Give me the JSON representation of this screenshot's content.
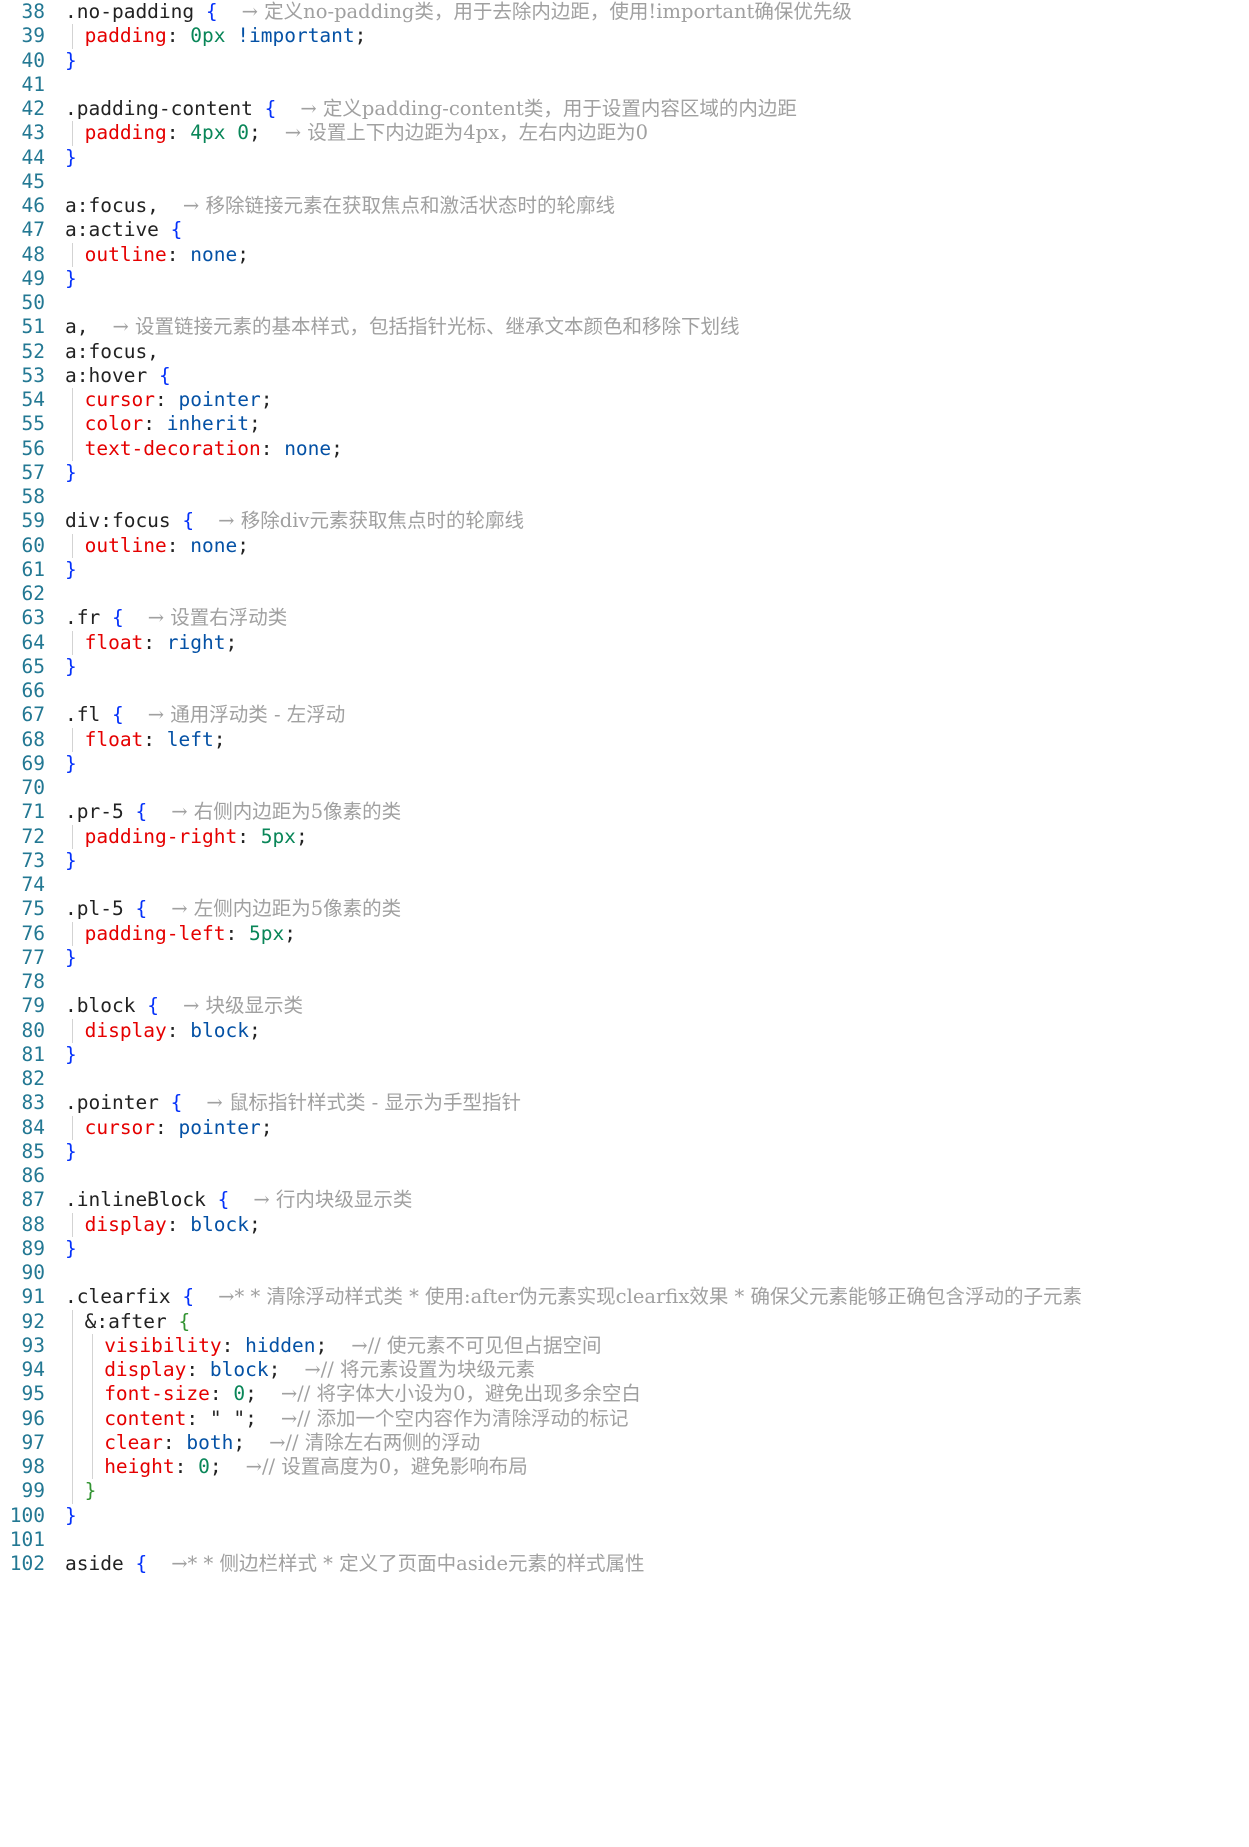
{
  "editor": {
    "lines": [
      {
        "num": "38",
        "indent": 0,
        "tokens": [
          {
            "t": ".no-padding",
            "c": "sel"
          },
          {
            "t": " ",
            "c": "punc"
          },
          {
            "t": "{",
            "c": "brace"
          }
        ],
        "comment": "→ 定义no-padding类，用于去除内边距，使用!important确保优先级"
      },
      {
        "num": "39",
        "indent": 1,
        "tokens": [
          {
            "t": "padding",
            "c": "prop"
          },
          {
            "t": ": ",
            "c": "punc"
          },
          {
            "t": "0px",
            "c": "num"
          },
          {
            "t": " ",
            "c": "punc"
          },
          {
            "t": "!important",
            "c": "val"
          },
          {
            "t": ";",
            "c": "punc"
          }
        ],
        "comment": ""
      },
      {
        "num": "40",
        "indent": 0,
        "tokens": [
          {
            "t": "}",
            "c": "brace"
          }
        ],
        "comment": ""
      },
      {
        "num": "41",
        "indent": 0,
        "tokens": [],
        "comment": ""
      },
      {
        "num": "42",
        "indent": 0,
        "tokens": [
          {
            "t": ".padding-content",
            "c": "sel"
          },
          {
            "t": " ",
            "c": "punc"
          },
          {
            "t": "{",
            "c": "brace"
          }
        ],
        "comment": "→ 定义padding-content类，用于设置内容区域的内边距"
      },
      {
        "num": "43",
        "indent": 1,
        "tokens": [
          {
            "t": "padding",
            "c": "prop"
          },
          {
            "t": ": ",
            "c": "punc"
          },
          {
            "t": "4px 0",
            "c": "num"
          },
          {
            "t": ";",
            "c": "punc"
          }
        ],
        "comment": "→ 设置上下内边距为4px，左右内边距为0"
      },
      {
        "num": "44",
        "indent": 0,
        "tokens": [
          {
            "t": "}",
            "c": "brace"
          }
        ],
        "comment": ""
      },
      {
        "num": "45",
        "indent": 0,
        "tokens": [],
        "comment": ""
      },
      {
        "num": "46",
        "indent": 0,
        "tokens": [
          {
            "t": "a:focus,",
            "c": "sel"
          }
        ],
        "comment": "→ 移除链接元素在获取焦点和激活状态时的轮廓线"
      },
      {
        "num": "47",
        "indent": 0,
        "tokens": [
          {
            "t": "a:active",
            "c": "sel"
          },
          {
            "t": " ",
            "c": "punc"
          },
          {
            "t": "{",
            "c": "brace"
          }
        ],
        "comment": ""
      },
      {
        "num": "48",
        "indent": 1,
        "tokens": [
          {
            "t": "outline",
            "c": "prop"
          },
          {
            "t": ": ",
            "c": "punc"
          },
          {
            "t": "none",
            "c": "val"
          },
          {
            "t": ";",
            "c": "punc"
          }
        ],
        "comment": ""
      },
      {
        "num": "49",
        "indent": 0,
        "tokens": [
          {
            "t": "}",
            "c": "brace"
          }
        ],
        "comment": ""
      },
      {
        "num": "50",
        "indent": 0,
        "tokens": [],
        "comment": ""
      },
      {
        "num": "51",
        "indent": 0,
        "tokens": [
          {
            "t": "a,",
            "c": "sel"
          }
        ],
        "comment": "→ 设置链接元素的基本样式，包括指针光标、继承文本颜色和移除下划线"
      },
      {
        "num": "52",
        "indent": 0,
        "tokens": [
          {
            "t": "a:focus,",
            "c": "sel"
          }
        ],
        "comment": ""
      },
      {
        "num": "53",
        "indent": 0,
        "tokens": [
          {
            "t": "a:hover",
            "c": "sel"
          },
          {
            "t": " ",
            "c": "punc"
          },
          {
            "t": "{",
            "c": "brace"
          }
        ],
        "comment": ""
      },
      {
        "num": "54",
        "indent": 1,
        "tokens": [
          {
            "t": "cursor",
            "c": "prop"
          },
          {
            "t": ": ",
            "c": "punc"
          },
          {
            "t": "pointer",
            "c": "val"
          },
          {
            "t": ";",
            "c": "punc"
          }
        ],
        "comment": ""
      },
      {
        "num": "55",
        "indent": 1,
        "tokens": [
          {
            "t": "color",
            "c": "prop"
          },
          {
            "t": ": ",
            "c": "punc"
          },
          {
            "t": "inherit",
            "c": "val"
          },
          {
            "t": ";",
            "c": "punc"
          }
        ],
        "comment": ""
      },
      {
        "num": "56",
        "indent": 1,
        "tokens": [
          {
            "t": "text-decoration",
            "c": "prop"
          },
          {
            "t": ": ",
            "c": "punc"
          },
          {
            "t": "none",
            "c": "val"
          },
          {
            "t": ";",
            "c": "punc"
          }
        ],
        "comment": ""
      },
      {
        "num": "57",
        "indent": 0,
        "tokens": [
          {
            "t": "}",
            "c": "brace"
          }
        ],
        "comment": ""
      },
      {
        "num": "58",
        "indent": 0,
        "tokens": [],
        "comment": ""
      },
      {
        "num": "59",
        "indent": 0,
        "tokens": [
          {
            "t": "div:focus",
            "c": "sel"
          },
          {
            "t": " ",
            "c": "punc"
          },
          {
            "t": "{",
            "c": "brace"
          }
        ],
        "comment": "→ 移除div元素获取焦点时的轮廓线"
      },
      {
        "num": "60",
        "indent": 1,
        "tokens": [
          {
            "t": "outline",
            "c": "prop"
          },
          {
            "t": ": ",
            "c": "punc"
          },
          {
            "t": "none",
            "c": "val"
          },
          {
            "t": ";",
            "c": "punc"
          }
        ],
        "comment": ""
      },
      {
        "num": "61",
        "indent": 0,
        "tokens": [
          {
            "t": "}",
            "c": "brace"
          }
        ],
        "comment": ""
      },
      {
        "num": "62",
        "indent": 0,
        "tokens": [],
        "comment": ""
      },
      {
        "num": "63",
        "indent": 0,
        "tokens": [
          {
            "t": ".fr",
            "c": "sel"
          },
          {
            "t": " ",
            "c": "punc"
          },
          {
            "t": "{",
            "c": "brace"
          }
        ],
        "comment": "→ 设置右浮动类"
      },
      {
        "num": "64",
        "indent": 1,
        "tokens": [
          {
            "t": "float",
            "c": "prop"
          },
          {
            "t": ": ",
            "c": "punc"
          },
          {
            "t": "right",
            "c": "val"
          },
          {
            "t": ";",
            "c": "punc"
          }
        ],
        "comment": ""
      },
      {
        "num": "65",
        "indent": 0,
        "tokens": [
          {
            "t": "}",
            "c": "brace"
          }
        ],
        "comment": ""
      },
      {
        "num": "66",
        "indent": 0,
        "tokens": [],
        "comment": ""
      },
      {
        "num": "67",
        "indent": 0,
        "tokens": [
          {
            "t": ".fl",
            "c": "sel"
          },
          {
            "t": " ",
            "c": "punc"
          },
          {
            "t": "{",
            "c": "brace"
          }
        ],
        "comment": "→ 通用浮动类 - 左浮动"
      },
      {
        "num": "68",
        "indent": 1,
        "tokens": [
          {
            "t": "float",
            "c": "prop"
          },
          {
            "t": ": ",
            "c": "punc"
          },
          {
            "t": "left",
            "c": "val"
          },
          {
            "t": ";",
            "c": "punc"
          }
        ],
        "comment": ""
      },
      {
        "num": "69",
        "indent": 0,
        "tokens": [
          {
            "t": "}",
            "c": "brace"
          }
        ],
        "comment": ""
      },
      {
        "num": "70",
        "indent": 0,
        "tokens": [],
        "comment": ""
      },
      {
        "num": "71",
        "indent": 0,
        "tokens": [
          {
            "t": ".pr-5",
            "c": "sel"
          },
          {
            "t": " ",
            "c": "punc"
          },
          {
            "t": "{",
            "c": "brace"
          }
        ],
        "comment": "→ 右侧内边距为5像素的类"
      },
      {
        "num": "72",
        "indent": 1,
        "tokens": [
          {
            "t": "padding-right",
            "c": "prop"
          },
          {
            "t": ": ",
            "c": "punc"
          },
          {
            "t": "5px",
            "c": "num"
          },
          {
            "t": ";",
            "c": "punc"
          }
        ],
        "comment": ""
      },
      {
        "num": "73",
        "indent": 0,
        "tokens": [
          {
            "t": "}",
            "c": "brace"
          }
        ],
        "comment": ""
      },
      {
        "num": "74",
        "indent": 0,
        "tokens": [],
        "comment": ""
      },
      {
        "num": "75",
        "indent": 0,
        "tokens": [
          {
            "t": ".pl-5",
            "c": "sel"
          },
          {
            "t": " ",
            "c": "punc"
          },
          {
            "t": "{",
            "c": "brace"
          }
        ],
        "comment": "→ 左侧内边距为5像素的类"
      },
      {
        "num": "76",
        "indent": 1,
        "tokens": [
          {
            "t": "padding-left",
            "c": "prop"
          },
          {
            "t": ": ",
            "c": "punc"
          },
          {
            "t": "5px",
            "c": "num"
          },
          {
            "t": ";",
            "c": "punc"
          }
        ],
        "comment": ""
      },
      {
        "num": "77",
        "indent": 0,
        "tokens": [
          {
            "t": "}",
            "c": "brace"
          }
        ],
        "comment": ""
      },
      {
        "num": "78",
        "indent": 0,
        "tokens": [],
        "comment": ""
      },
      {
        "num": "79",
        "indent": 0,
        "tokens": [
          {
            "t": ".block",
            "c": "sel"
          },
          {
            "t": " ",
            "c": "punc"
          },
          {
            "t": "{",
            "c": "brace"
          }
        ],
        "comment": "→ 块级显示类"
      },
      {
        "num": "80",
        "indent": 1,
        "tokens": [
          {
            "t": "display",
            "c": "prop"
          },
          {
            "t": ": ",
            "c": "punc"
          },
          {
            "t": "block",
            "c": "val"
          },
          {
            "t": ";",
            "c": "punc"
          }
        ],
        "comment": ""
      },
      {
        "num": "81",
        "indent": 0,
        "tokens": [
          {
            "t": "}",
            "c": "brace"
          }
        ],
        "comment": ""
      },
      {
        "num": "82",
        "indent": 0,
        "tokens": [],
        "comment": ""
      },
      {
        "num": "83",
        "indent": 0,
        "tokens": [
          {
            "t": ".pointer",
            "c": "sel"
          },
          {
            "t": " ",
            "c": "punc"
          },
          {
            "t": "{",
            "c": "brace"
          }
        ],
        "comment": "→ 鼠标指针样式类 - 显示为手型指针"
      },
      {
        "num": "84",
        "indent": 1,
        "tokens": [
          {
            "t": "cursor",
            "c": "prop"
          },
          {
            "t": ": ",
            "c": "punc"
          },
          {
            "t": "pointer",
            "c": "val"
          },
          {
            "t": ";",
            "c": "punc"
          }
        ],
        "comment": ""
      },
      {
        "num": "85",
        "indent": 0,
        "tokens": [
          {
            "t": "}",
            "c": "brace"
          }
        ],
        "comment": ""
      },
      {
        "num": "86",
        "indent": 0,
        "tokens": [],
        "comment": ""
      },
      {
        "num": "87",
        "indent": 0,
        "tokens": [
          {
            "t": ".inlineBlock",
            "c": "sel"
          },
          {
            "t": " ",
            "c": "punc"
          },
          {
            "t": "{",
            "c": "brace"
          }
        ],
        "comment": "→ 行内块级显示类"
      },
      {
        "num": "88",
        "indent": 1,
        "tokens": [
          {
            "t": "display",
            "c": "prop"
          },
          {
            "t": ": ",
            "c": "punc"
          },
          {
            "t": "block",
            "c": "val"
          },
          {
            "t": ";",
            "c": "punc"
          }
        ],
        "comment": ""
      },
      {
        "num": "89",
        "indent": 0,
        "tokens": [
          {
            "t": "}",
            "c": "brace"
          }
        ],
        "comment": ""
      },
      {
        "num": "90",
        "indent": 0,
        "tokens": [],
        "comment": ""
      },
      {
        "num": "91",
        "indent": 0,
        "tokens": [
          {
            "t": ".clearfix",
            "c": "sel"
          },
          {
            "t": " ",
            "c": "punc"
          },
          {
            "t": "{",
            "c": "brace"
          }
        ],
        "comment": "→* * 清除浮动样式类 * 使用:after伪元素实现clearfix效果 * 确保父元素能够正确包含浮动的子元素"
      },
      {
        "num": "92",
        "indent": 1,
        "tokens": [
          {
            "t": "&:after",
            "c": "sel"
          },
          {
            "t": " ",
            "c": "punc"
          },
          {
            "t": "{",
            "c": "brace2"
          }
        ],
        "comment": ""
      },
      {
        "num": "93",
        "indent": 2,
        "tokens": [
          {
            "t": "visibility",
            "c": "prop"
          },
          {
            "t": ": ",
            "c": "punc"
          },
          {
            "t": "hidden",
            "c": "val"
          },
          {
            "t": ";",
            "c": "punc"
          }
        ],
        "comment": "→// 使元素不可见但占据空间"
      },
      {
        "num": "94",
        "indent": 2,
        "tokens": [
          {
            "t": "display",
            "c": "prop"
          },
          {
            "t": ": ",
            "c": "punc"
          },
          {
            "t": "block",
            "c": "val"
          },
          {
            "t": ";",
            "c": "punc"
          }
        ],
        "comment": "→// 将元素设置为块级元素"
      },
      {
        "num": "95",
        "indent": 2,
        "tokens": [
          {
            "t": "font-size",
            "c": "prop"
          },
          {
            "t": ": ",
            "c": "punc"
          },
          {
            "t": "0",
            "c": "num"
          },
          {
            "t": ";",
            "c": "punc"
          }
        ],
        "comment": "→// 将字体大小设为0，避免出现多余空白"
      },
      {
        "num": "96",
        "indent": 2,
        "tokens": [
          {
            "t": "content",
            "c": "prop"
          },
          {
            "t": ": ",
            "c": "punc"
          },
          {
            "t": "\" \"",
            "c": "sel"
          },
          {
            "t": ";",
            "c": "punc"
          }
        ],
        "comment": "→// 添加一个空内容作为清除浮动的标记"
      },
      {
        "num": "97",
        "indent": 2,
        "tokens": [
          {
            "t": "clear",
            "c": "prop"
          },
          {
            "t": ": ",
            "c": "punc"
          },
          {
            "t": "both",
            "c": "val"
          },
          {
            "t": ";",
            "c": "punc"
          }
        ],
        "comment": "→// 清除左右两侧的浮动"
      },
      {
        "num": "98",
        "indent": 2,
        "tokens": [
          {
            "t": "height",
            "c": "prop"
          },
          {
            "t": ": ",
            "c": "punc"
          },
          {
            "t": "0",
            "c": "num"
          },
          {
            "t": ";",
            "c": "punc"
          }
        ],
        "comment": "→// 设置高度为0，避免影响布局"
      },
      {
        "num": "99",
        "indent": 1,
        "tokens": [
          {
            "t": "}",
            "c": "brace2"
          }
        ],
        "comment": ""
      },
      {
        "num": "100",
        "indent": 0,
        "tokens": [
          {
            "t": "}",
            "c": "brace"
          }
        ],
        "comment": ""
      },
      {
        "num": "101",
        "indent": 0,
        "tokens": [],
        "comment": ""
      },
      {
        "num": "102",
        "indent": 0,
        "tokens": [
          {
            "t": "aside",
            "c": "sel"
          },
          {
            "t": " ",
            "c": "punc"
          },
          {
            "t": "{",
            "c": "brace"
          }
        ],
        "comment": "→* * 侧边栏样式 * 定义了页面中aside元素的样式属性"
      }
    ]
  }
}
